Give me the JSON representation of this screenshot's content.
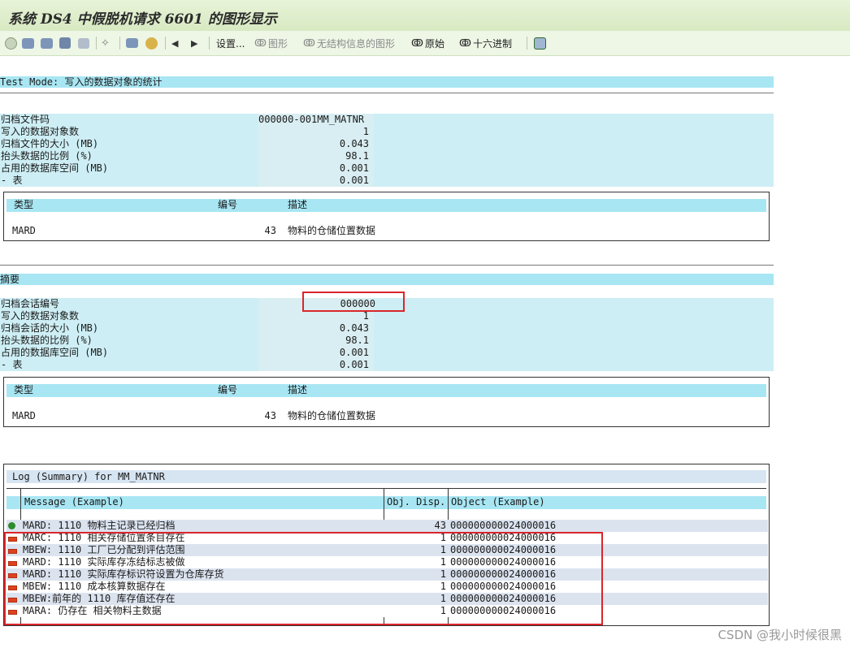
{
  "window": {
    "title": "系统 DS4 中假脱机请求 6601 的图形显示"
  },
  "toolbar": {
    "settings_label": "设置...",
    "graphics_label": "图形",
    "unstructured_label": "无结构信息的图形",
    "raw_label": "原始",
    "hex_label": "十六进制",
    "icons": [
      "refresh-icon",
      "print-icon",
      "print-preview-icon",
      "delete-icon",
      "printer-icon",
      "graphic-icon",
      "find-icon",
      "user-icon",
      "prev-page-icon",
      "next-page-icon",
      "export-icon"
    ]
  },
  "section1": {
    "header": "Test Mode: 写入的数据对象的统计",
    "rows": [
      {
        "label": "归档文件码",
        "value": "000000-001MM_MATNR"
      },
      {
        "label": "写入的数据对象数",
        "value": "1"
      },
      {
        "label": "归档文件的大小 (MB)",
        "value": "0.043"
      },
      {
        "label": "抬头数据的比例 (%)",
        "value": "98.1"
      },
      {
        "label": "占用的数据库空间 (MB)",
        "value": "0.001"
      },
      {
        "label": "- 表",
        "value": "0.001"
      }
    ],
    "table": {
      "columns": [
        "类型",
        "编号",
        "描述"
      ],
      "row": {
        "type": "MARD",
        "number": "43",
        "desc": "物料的仓储位置数据"
      }
    }
  },
  "section2": {
    "header": "摘要",
    "rows": [
      {
        "label": "归档会话编号",
        "value": "000000"
      },
      {
        "label": "写入的数据对象数",
        "value": "1"
      },
      {
        "label": "归档会话的大小 (MB)",
        "value": "0.043"
      },
      {
        "label": "抬头数据的比例 (%)",
        "value": "98.1"
      },
      {
        "label": "占用的数据库空间 (MB)",
        "value": "0.001"
      },
      {
        "label": "- 表",
        "value": "0.001"
      }
    ],
    "table": {
      "columns": [
        "类型",
        "编号",
        "描述"
      ],
      "row": {
        "type": "MARD",
        "number": "43",
        "desc": "物料的仓储位置数据"
      }
    }
  },
  "log": {
    "title": "Log (Summary) for MM_MATNR",
    "columns": [
      "Message (Example)",
      "Obj. Disp.",
      "Object (Example)"
    ],
    "rows": [
      {
        "status": "ok",
        "message": "MARD: 1110 物料主记录已经归档",
        "count": "43",
        "object": "000000000024000016"
      },
      {
        "status": "error",
        "message": "MARC: 1110 相关存储位置条目存在",
        "count": "1",
        "object": "000000000024000016"
      },
      {
        "status": "error",
        "message": "MBEW: 1110 工厂已分配到评估范围",
        "count": "1",
        "object": "000000000024000016"
      },
      {
        "status": "error",
        "message": "MARD: 1110 实际库存冻结标志被做",
        "count": "1",
        "object": "000000000024000016"
      },
      {
        "status": "error",
        "message": "MARD: 1110 实际库存标识符设置为仓库存货",
        "count": "1",
        "object": "000000000024000016"
      },
      {
        "status": "error",
        "message": "MBEW: 1110 成本核算数据存在",
        "count": "1",
        "object": "000000000024000016"
      },
      {
        "status": "error",
        "message": "MBEW:前年的 1110 库存值还存在",
        "count": "1",
        "object": "000000000024000016"
      },
      {
        "status": "error",
        "message": "MARA: 仍存在 相关物料主数据",
        "count": "1",
        "object": "000000000024000016"
      }
    ]
  },
  "watermark": "CSDN @我小时候很黑"
}
